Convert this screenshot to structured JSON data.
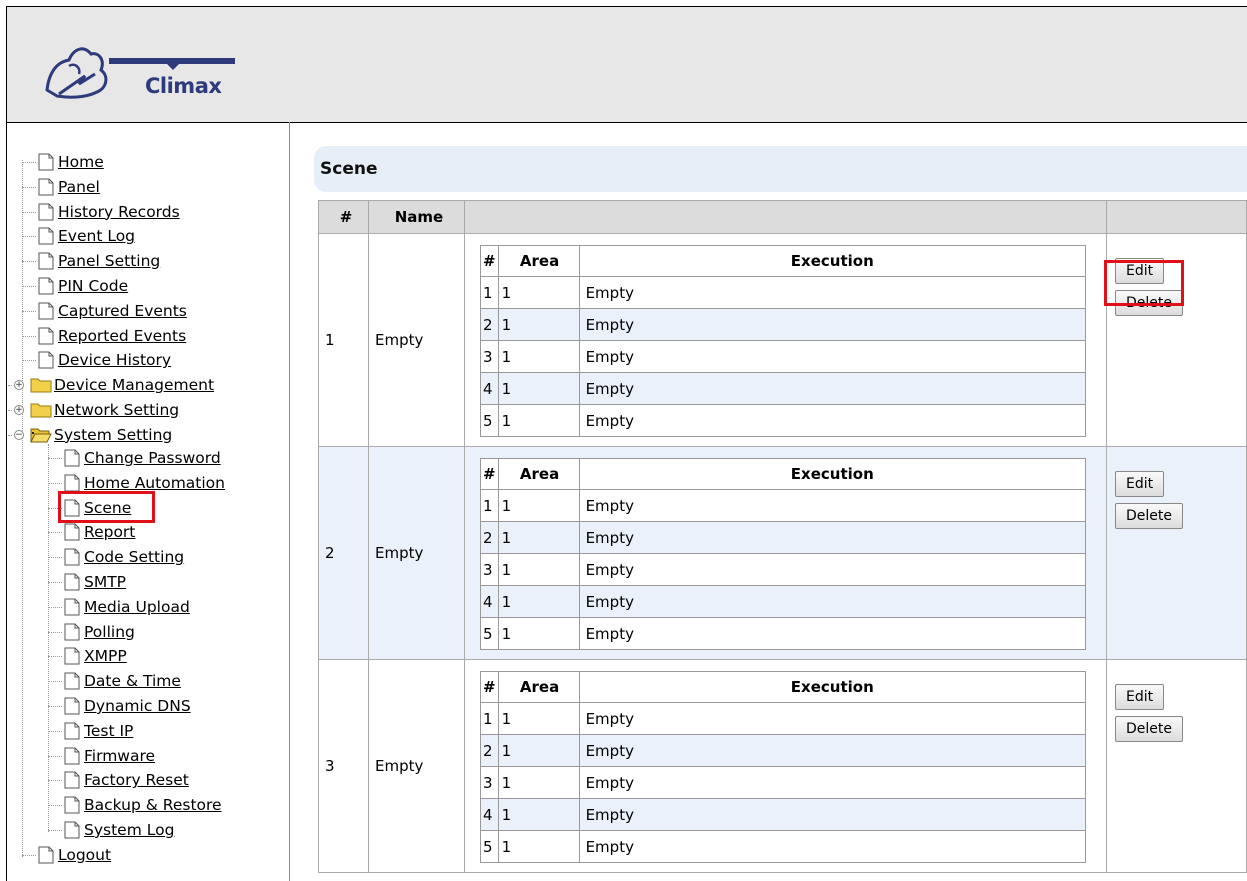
{
  "brand": {
    "logo_text": "Climax"
  },
  "nav": {
    "items": [
      {
        "label": "Home"
      },
      {
        "label": "Panel"
      },
      {
        "label": "History Records"
      },
      {
        "label": "Event Log"
      },
      {
        "label": "Panel Setting"
      },
      {
        "label": "PIN Code"
      },
      {
        "label": "Captured Events"
      },
      {
        "label": "Reported Events"
      },
      {
        "label": "Device History"
      },
      {
        "label": "Device Management",
        "expander": "+"
      },
      {
        "label": "Network Setting",
        "expander": "+"
      },
      {
        "label": "System Setting",
        "expander": "−"
      }
    ],
    "system_children": [
      {
        "label": "Change Password"
      },
      {
        "label": "Home Automation"
      },
      {
        "label": "Scene",
        "selected": true
      },
      {
        "label": "Report"
      },
      {
        "label": "Code Setting"
      },
      {
        "label": "SMTP"
      },
      {
        "label": "Media Upload"
      },
      {
        "label": "Polling"
      },
      {
        "label": "XMPP"
      },
      {
        "label": "Date & Time"
      },
      {
        "label": "Dynamic DNS"
      },
      {
        "label": "Test IP"
      },
      {
        "label": "Firmware"
      },
      {
        "label": "Factory Reset"
      },
      {
        "label": "Backup & Restore"
      },
      {
        "label": "System Log"
      }
    ],
    "logout": {
      "label": "Logout"
    }
  },
  "page": {
    "title": "Scene"
  },
  "table": {
    "headers": {
      "num": "#",
      "name": "Name"
    },
    "sub_headers": {
      "num": "#",
      "area": "Area",
      "execution": "Execution"
    },
    "edit_label": "Edit",
    "delete_label": "Delete",
    "scenes": [
      {
        "num": "1",
        "name": "Empty",
        "rows": [
          {
            "num": "1",
            "area": "1",
            "execution": "Empty"
          },
          {
            "num": "2",
            "area": "1",
            "execution": "Empty"
          },
          {
            "num": "3",
            "area": "1",
            "execution": "Empty"
          },
          {
            "num": "4",
            "area": "1",
            "execution": "Empty"
          },
          {
            "num": "5",
            "area": "1",
            "execution": "Empty"
          }
        ]
      },
      {
        "num": "2",
        "name": "Empty",
        "rows": [
          {
            "num": "1",
            "area": "1",
            "execution": "Empty"
          },
          {
            "num": "2",
            "area": "1",
            "execution": "Empty"
          },
          {
            "num": "3",
            "area": "1",
            "execution": "Empty"
          },
          {
            "num": "4",
            "area": "1",
            "execution": "Empty"
          },
          {
            "num": "5",
            "area": "1",
            "execution": "Empty"
          }
        ]
      },
      {
        "num": "3",
        "name": "Empty",
        "rows": [
          {
            "num": "1",
            "area": "1",
            "execution": "Empty"
          },
          {
            "num": "2",
            "area": "1",
            "execution": "Empty"
          },
          {
            "num": "3",
            "area": "1",
            "execution": "Empty"
          },
          {
            "num": "4",
            "area": "1",
            "execution": "Empty"
          },
          {
            "num": "5",
            "area": "1",
            "execution": "Empty"
          }
        ]
      }
    ]
  },
  "colors": {
    "highlight": "#e0101a",
    "alt_row": "#eaf1fa",
    "header_bg": "#e7e7e7",
    "title_bg": "#e6eef8"
  }
}
